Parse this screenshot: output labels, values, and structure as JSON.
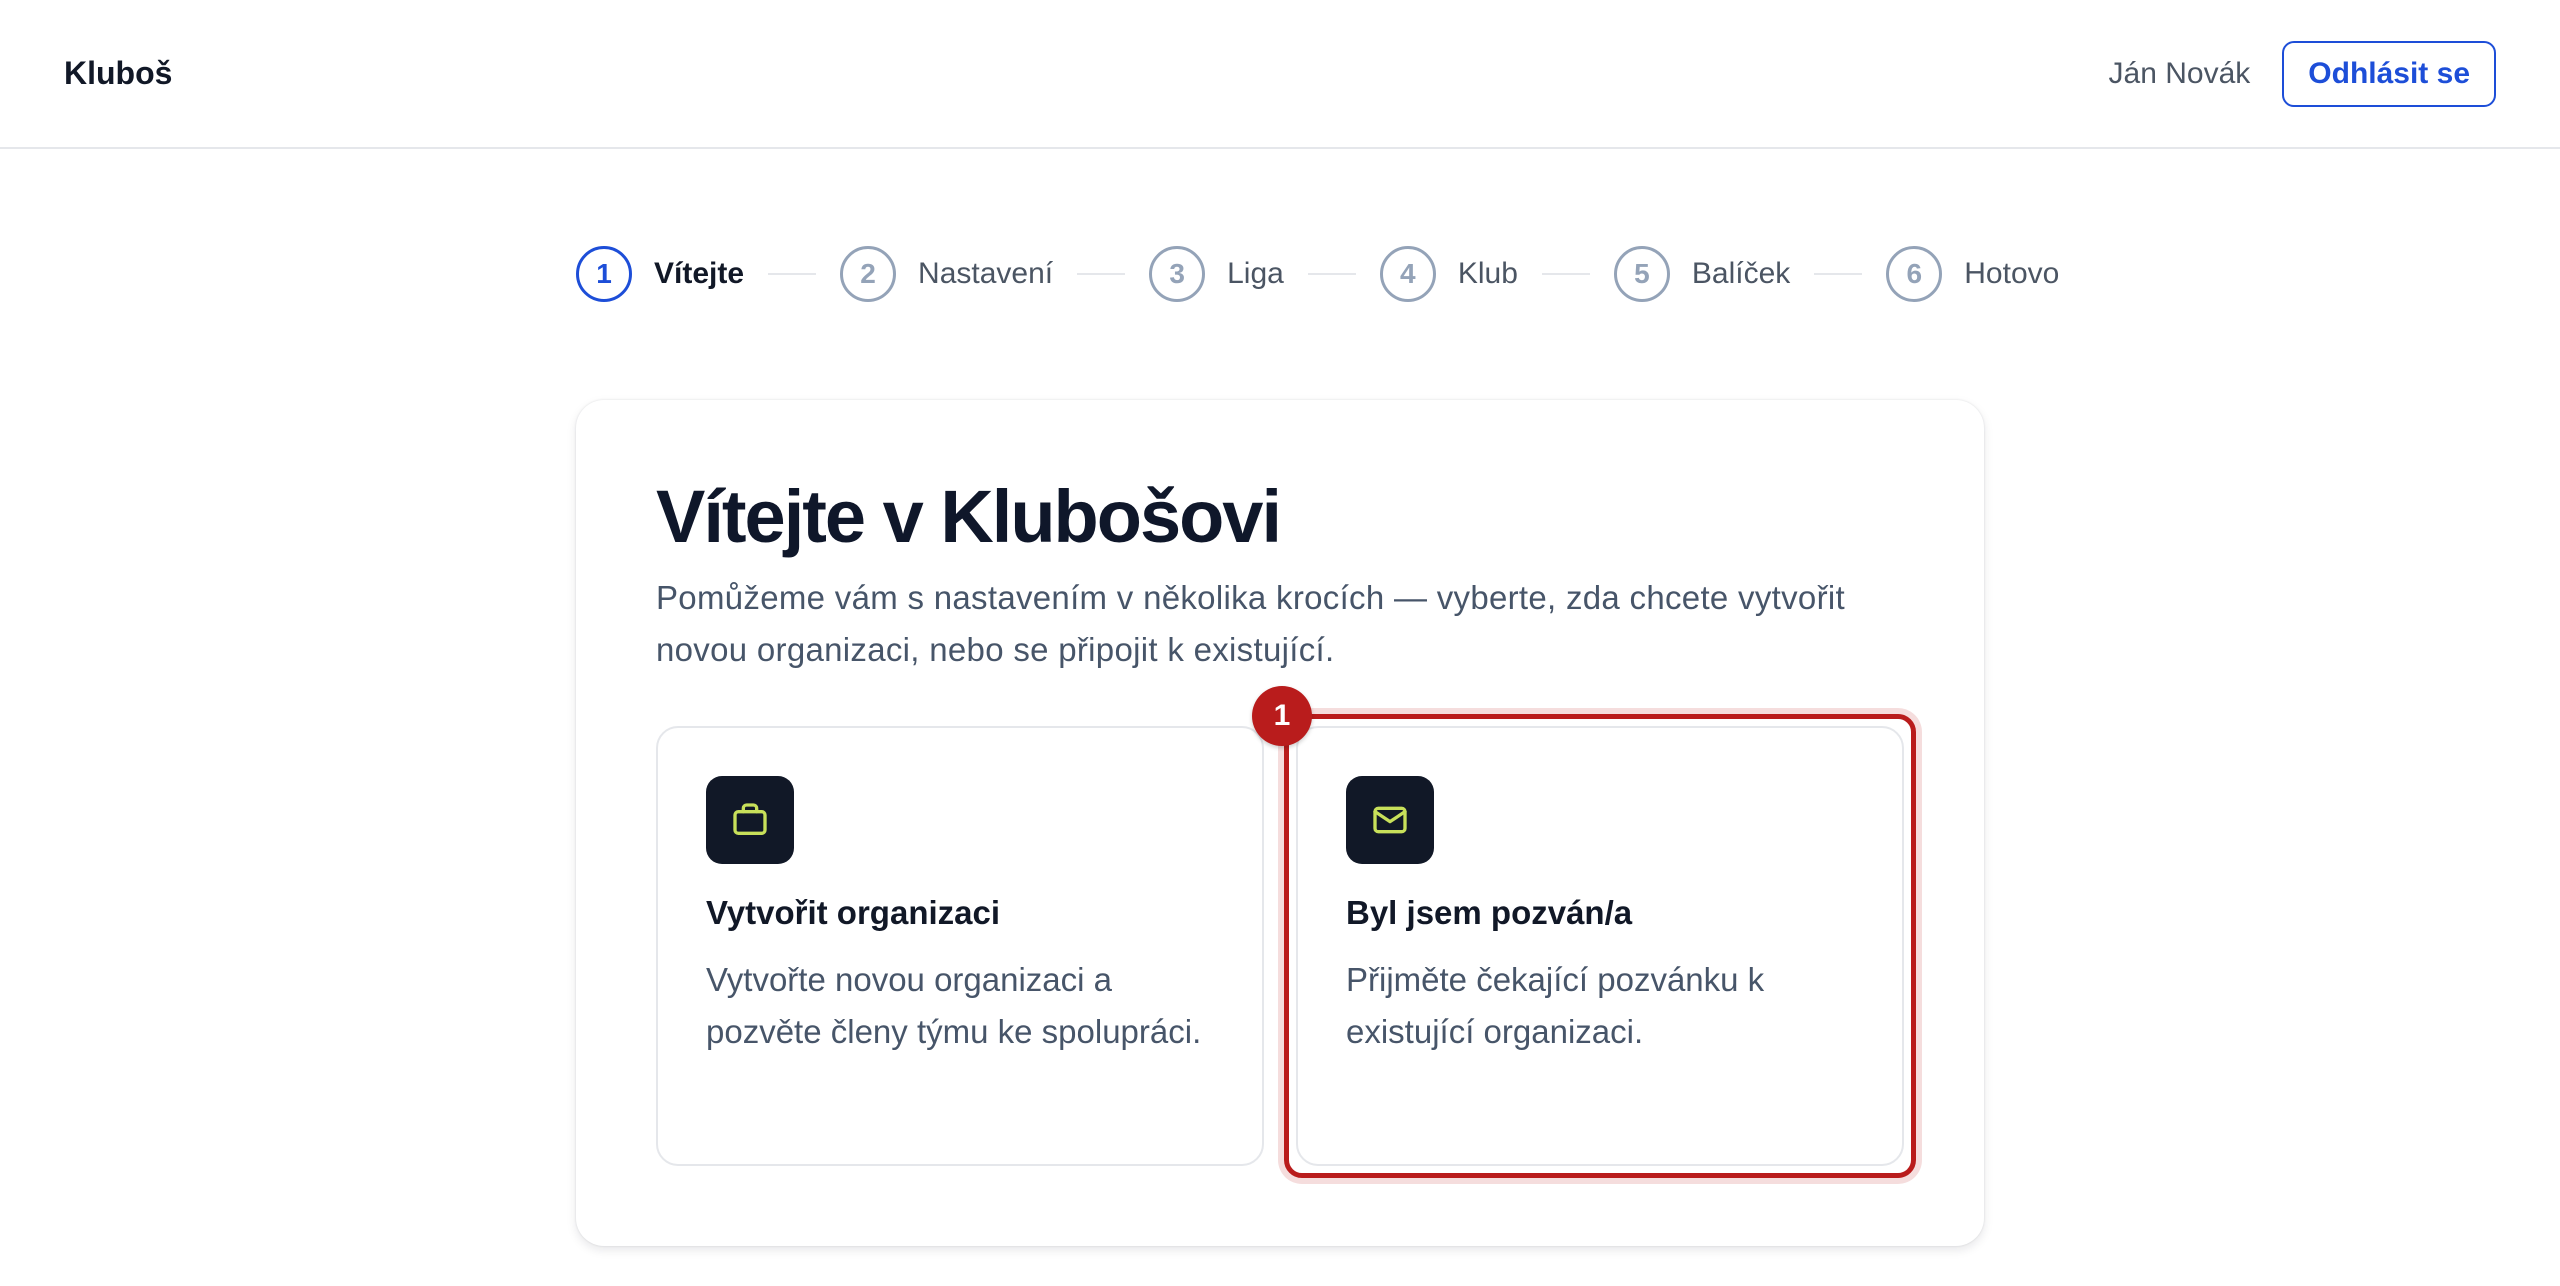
{
  "header": {
    "brand": "Kluboš",
    "user_name": "Ján Novák",
    "logout_label": "Odhlásit se"
  },
  "stepper": {
    "steps": [
      {
        "number": "1",
        "label": "Vítejte",
        "active": true
      },
      {
        "number": "2",
        "label": "Nastavení",
        "active": false
      },
      {
        "number": "3",
        "label": "Liga",
        "active": false
      },
      {
        "number": "4",
        "label": "Klub",
        "active": false
      },
      {
        "number": "5",
        "label": "Balíček",
        "active": false
      },
      {
        "number": "6",
        "label": "Hotovo",
        "active": false
      }
    ]
  },
  "welcome": {
    "title": "Vítejte v Klubošovi",
    "description": "Pomůžeme vám s nastavením v několika krocích — vyberte, zda chcete vytvořit novou organizaci, nebo se připojit k existující."
  },
  "options": [
    {
      "icon": "briefcase-icon",
      "title": "Vytvořit organizaci",
      "description": "Vytvořte novou organizaci a pozvěte členy týmu ke spolupráci."
    },
    {
      "icon": "envelope-icon",
      "title": "Byl jsem pozván/a",
      "description": "Přijměte čekající pozvánku k existující organizaci."
    }
  ],
  "annotation": {
    "badge": "1"
  },
  "colors": {
    "accent": "#1d4ed8",
    "icon_bg": "#111827",
    "icon_stroke": "#c8e05a",
    "highlight": "#b91c1c"
  }
}
